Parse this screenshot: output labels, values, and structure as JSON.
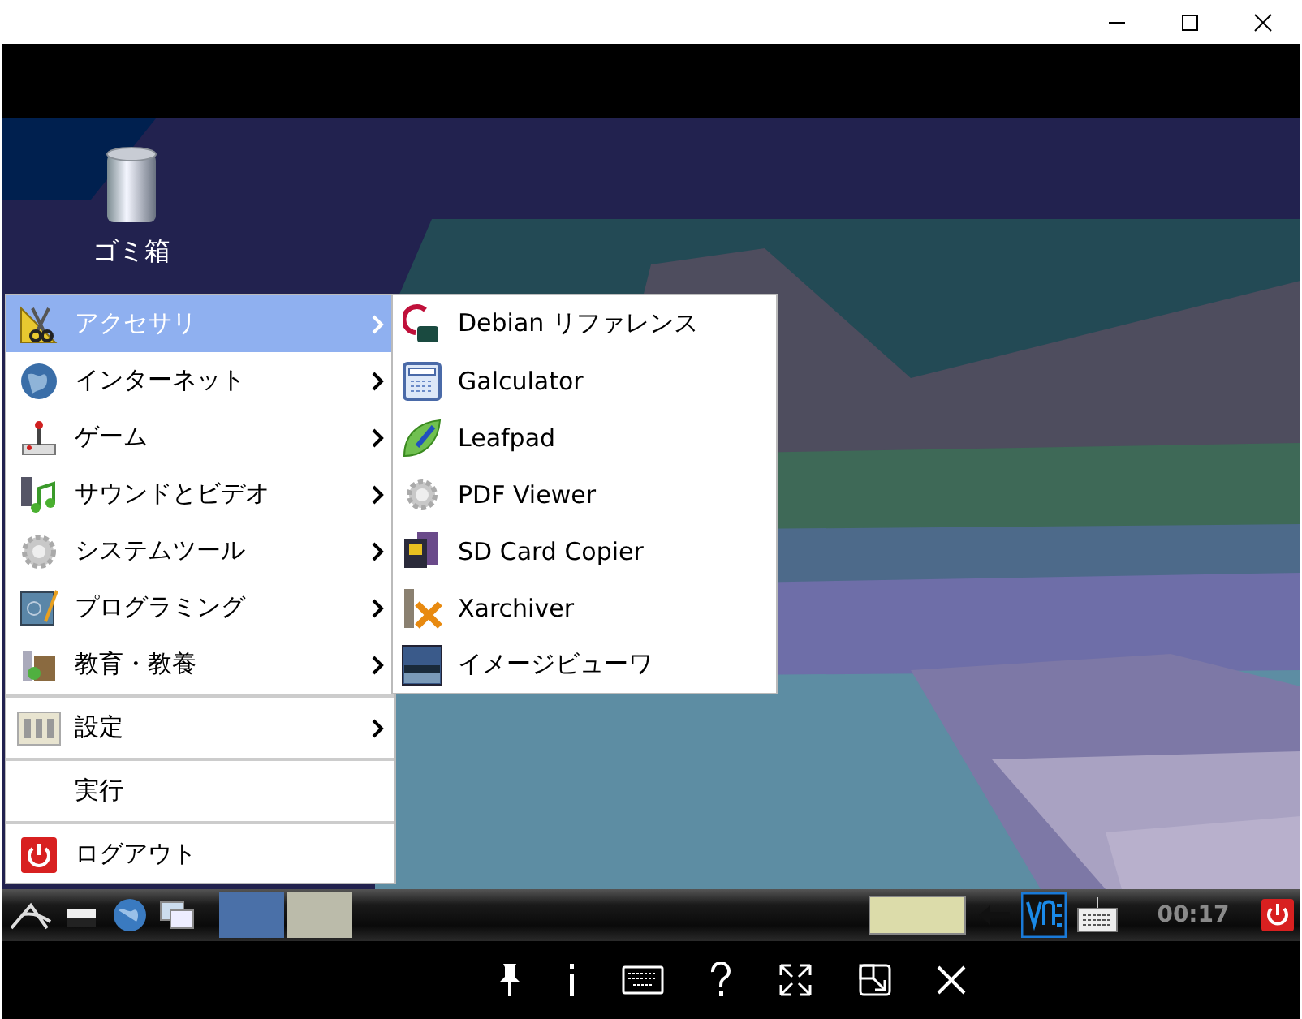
{
  "desktop": {
    "icons": [
      {
        "label": "ゴミ箱"
      }
    ]
  },
  "menu": {
    "groups": [
      [
        {
          "label": "アクセサリ",
          "submenu": true,
          "selected": true
        },
        {
          "label": "インターネット",
          "submenu": true,
          "selected": false
        },
        {
          "label": "ゲーム",
          "submenu": true,
          "selected": false
        },
        {
          "label": "サウンドとビデオ",
          "submenu": true,
          "selected": false
        },
        {
          "label": "システムツール",
          "submenu": true,
          "selected": false
        },
        {
          "label": "プログラミング",
          "submenu": true,
          "selected": false
        },
        {
          "label": "教育・教養",
          "submenu": true,
          "selected": false
        }
      ],
      [
        {
          "label": "設定",
          "submenu": true,
          "selected": false
        }
      ],
      [
        {
          "label": "実行",
          "submenu": false,
          "selected": false
        }
      ],
      [
        {
          "label": "ログアウト",
          "submenu": false,
          "selected": false
        }
      ]
    ]
  },
  "submenu": {
    "items": [
      {
        "label": "Debian リファレンス"
      },
      {
        "label": "Galculator"
      },
      {
        "label": "Leafpad"
      },
      {
        "label": "PDF Viewer"
      },
      {
        "label": "SD Card Copier"
      },
      {
        "label": "Xarchiver"
      },
      {
        "label": "イメージビューワ"
      }
    ]
  },
  "taskbar": {
    "windows": [
      {
        "selected": true
      },
      {
        "selected": false
      }
    ],
    "clock": "00:17"
  }
}
